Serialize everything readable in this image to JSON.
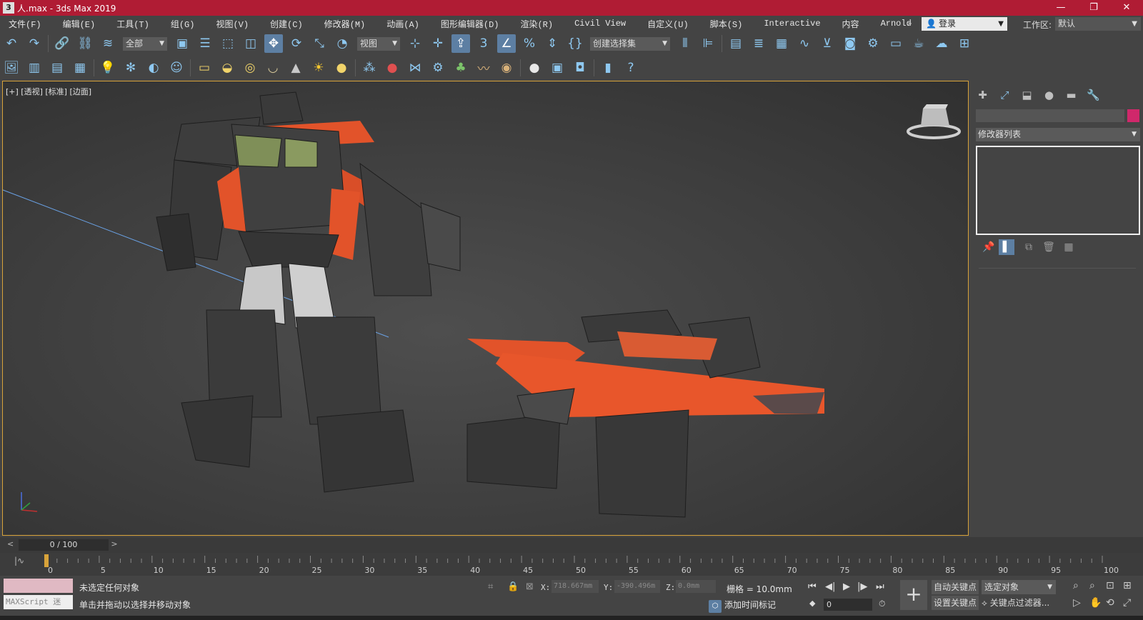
{
  "window": {
    "app_icon": "3",
    "title": "人.max - 3ds Max 2019",
    "controls": [
      "—",
      "❐",
      "✕"
    ]
  },
  "menu": [
    "文件(F)",
    "编辑(E)",
    "工具(T)",
    "组(G)",
    "视图(V)",
    "创建(C)",
    "修改器(M)",
    "动画(A)",
    "图形编辑器(D)",
    "渲染(R)",
    "Civil View",
    "自定义(U)",
    "脚本(S)",
    "Interactive",
    "内容",
    "Arnold"
  ],
  "menu_more": "»",
  "login": {
    "label": "登录",
    "icon": "person-icon"
  },
  "workspace": {
    "label": "工作区:",
    "value": "默认"
  },
  "toolbar1": {
    "selection_filter": "全部",
    "ref_coord": "视图",
    "named_selection": "创建选择集",
    "snap_label": "3"
  },
  "viewport": {
    "label": "[+] [透视] [标准] [边面]",
    "accent": "#d8a33a"
  },
  "command_panel": {
    "modifier_list": "修改器列表",
    "object_color": "#d0286b"
  },
  "time_slider": {
    "current": "0 / 100",
    "prev": "<",
    "next": ">"
  },
  "trackbar": {
    "start": 0,
    "end": 100,
    "current_frame": 0,
    "labels": [
      "0",
      "5",
      "10",
      "15",
      "20",
      "25",
      "30",
      "35",
      "40",
      "45",
      "50",
      "55",
      "60",
      "65",
      "70",
      "75",
      "80",
      "85",
      "90",
      "95",
      "100"
    ]
  },
  "status": {
    "listener": "MAXScript 迷",
    "line1": "未选定任何对象",
    "line2": "单击并拖动以选择并移动对象",
    "x_label": "X:",
    "x_value": "718.667mm",
    "y_label": "Y:",
    "y_value": "-390.496m",
    "z_label": "Z:",
    "z_value": "0.0mm",
    "grid": "栅格 = 10.0mm",
    "add_time_tag": "添加时间标记",
    "frame": "0",
    "auto_key": "自动关键点",
    "set_key": "设置关键点",
    "selected_object": "选定对象",
    "key_filter": "关键点过滤器..."
  }
}
